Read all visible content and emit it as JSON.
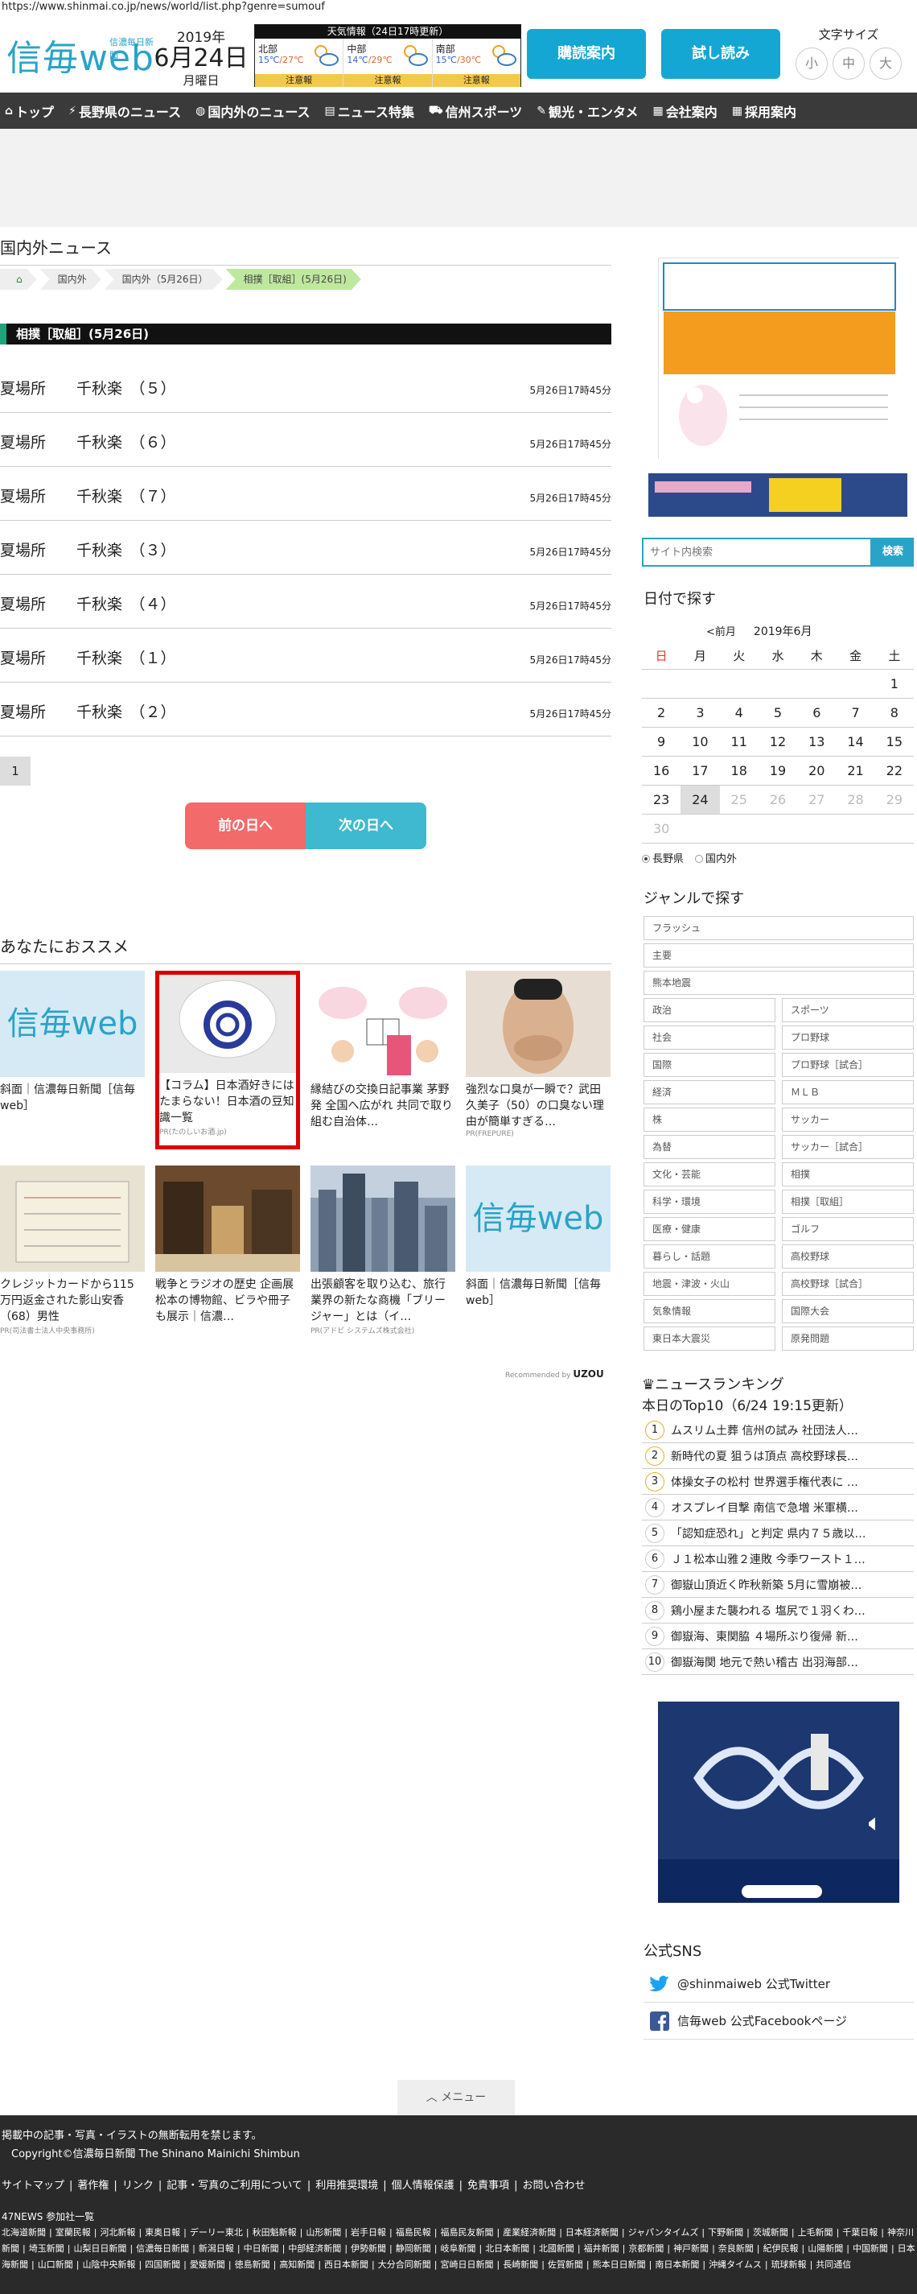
{
  "url": "https://www.shinmai.co.jp/news/world/list.php?genre=sumouf",
  "header": {
    "logo": "信毎web",
    "logo_sub": "信濃毎日新聞",
    "date_year": "2019年",
    "date_main": "6月24日",
    "date_dow": "月曜日",
    "weather_title": "天気情報（24日17時更新）",
    "weather": [
      {
        "name": "北部",
        "hi": "15℃",
        "lo": "27℃",
        "warn": "注意報"
      },
      {
        "name": "中部",
        "hi": "14℃",
        "lo": "29℃",
        "warn": "注意報"
      },
      {
        "name": "南部",
        "hi": "15℃",
        "lo": "30℃",
        "warn": "注意報"
      }
    ],
    "subscribe_label": "購読案内",
    "trial_label": "試し読み",
    "textsize_label": "文字サイズ",
    "textsize_small": "小",
    "textsize_medium": "中",
    "textsize_large": "大"
  },
  "nav": [
    {
      "label": "トップ"
    },
    {
      "label": "長野県のニュース"
    },
    {
      "label": "国内外のニュース"
    },
    {
      "label": "ニュース特集"
    },
    {
      "label": "信州スポーツ"
    },
    {
      "label": "観光・エンタメ"
    },
    {
      "label": "会社案内"
    },
    {
      "label": "採用案内"
    }
  ],
  "main": {
    "section_title": "国内外ニュース",
    "breadcrumbs": [
      "国内外",
      "国内外（5月26日）",
      "相撲［取組］(5月26日)"
    ],
    "category_title": "相撲［取組］(5月26日)",
    "articles": [
      {
        "title": "夏場所　　千秋楽　（５）",
        "time": "5月26日17時45分"
      },
      {
        "title": "夏場所　　千秋楽　（６）",
        "time": "5月26日17時45分"
      },
      {
        "title": "夏場所　　千秋楽　（７）",
        "time": "5月26日17時45分"
      },
      {
        "title": "夏場所　　千秋楽　（３）",
        "time": "5月26日17時45分"
      },
      {
        "title": "夏場所　　千秋楽　（４）",
        "time": "5月26日17時45分"
      },
      {
        "title": "夏場所　　千秋楽　（１）",
        "time": "5月26日17時45分"
      },
      {
        "title": "夏場所　　千秋楽　（２）",
        "time": "5月26日17時45分"
      }
    ],
    "page": "1",
    "prev_day": "前の日へ",
    "next_day": "次の日へ",
    "reco_title": "あなたにおススメ",
    "reco": [
      {
        "text": "斜面｜信濃毎日新聞［信毎web］",
        "pr": "",
        "img": "信毎web"
      },
      {
        "text": "【コラム】日本酒好きにはたまらない！日本酒の豆知識一覧",
        "pr": "PR(たのしいお酒.jp)",
        "img": ""
      },
      {
        "text": "縁結びの交換日記事業 茅野発 全国へ広がれ 共同で取り組む自治体…",
        "pr": "",
        "img": ""
      },
      {
        "text": "強烈な口臭が一瞬で？武田久美子（50）の口臭ない理由が簡単すぎる…",
        "pr": "PR(FREPURE)",
        "img": ""
      },
      {
        "text": "クレジットカードから115万円返金された影山安香（68）男性",
        "pr": "PR(司法書士法人中央事務所)",
        "img": ""
      },
      {
        "text": "戦争とラジオの歴史 企画展 松本の博物館、ビラや冊子も展示｜信濃…",
        "pr": "",
        "img": ""
      },
      {
        "text": "出張顧客を取り込む、旅行業界の新たな商機「ブリージャー」とは（イ…",
        "pr": "PR(アドビ システムズ株式会社)",
        "img": ""
      },
      {
        "text": "斜面｜信濃毎日新聞［信毎web］",
        "pr": "",
        "img": "信毎web"
      }
    ],
    "recommended_by": "Recommended by",
    "recommended_brand": "UZOU"
  },
  "sidebar": {
    "search_placeholder": "サイト内検索",
    "search_btn": "検索",
    "date_title": "日付で探す",
    "cal_prev": "<前月",
    "cal_month": "2019年6月",
    "weekdays": [
      "日",
      "月",
      "火",
      "水",
      "木",
      "金",
      "土"
    ],
    "weeks": [
      [
        "",
        "",
        "",
        "",
        "",
        "",
        "1"
      ],
      [
        "2",
        "3",
        "4",
        "5",
        "6",
        "7",
        "8"
      ],
      [
        "9",
        "10",
        "11",
        "12",
        "13",
        "14",
        "15"
      ],
      [
        "16",
        "17",
        "18",
        "19",
        "20",
        "21",
        "22"
      ],
      [
        "23",
        "24",
        "25",
        "26",
        "27",
        "28",
        "29"
      ],
      [
        "30",
        "",
        "",
        "",
        "",
        "",
        ""
      ]
    ],
    "radio_nagano": "長野県",
    "radio_world": "国内外",
    "genre_title": "ジャンルで探す",
    "genres_wide": [
      "フラッシュ",
      "主要",
      "熊本地震"
    ],
    "genres": [
      "政治",
      "スポーツ",
      "社会",
      "プロ野球",
      "国際",
      "プロ野球［試合］",
      "経済",
      "ＭＬＢ",
      "株",
      "サッカー",
      "為替",
      "サッカー［試合］",
      "文化・芸能",
      "相撲",
      "科学・環境",
      "相撲［取組］",
      "医療・健康",
      "ゴルフ",
      "暮らし・話題",
      "高校野球",
      "地震・津波・火山",
      "高校野球［試合］",
      "気象情報",
      "国際大会",
      "東日本大震災",
      "原発問題"
    ],
    "rank_title": "ニュースランキング",
    "rank_sub": "本日のTop10（6/24 19:15更新）",
    "ranking": [
      "ムスリム土葬 信州の試み 社団法人…",
      "新時代の夏 狙うは頂点 高校野球長…",
      "体操女子の松村 世界選手権代表に …",
      "オスプレイ目撃 南信で急増 米軍横…",
      "「認知症恐れ」と判定 県内７５歳以…",
      "Ｊ１松本山雅２連敗 今季ワースト１…",
      "御嶽山頂近く昨秋新築 5月に雪崩被…",
      "鶏小屋また襲われる 塩尻で１羽くわ…",
      "御嶽海、東関脇 ４場所ぶり復帰 新…",
      "御嶽海関 地元で熱い稽古 出羽海部…"
    ],
    "sns_title": "公式SNS",
    "twitter": "@shinmaiweb 公式Twitter",
    "facebook": "信毎web 公式Facebookページ"
  },
  "menu_label": "メニュー",
  "footer": {
    "notice": "掲載中の記事・写真・イラストの無断転用を禁じます。",
    "copyright": "Copyright©信濃毎日新聞 The Shinano Mainichi Shimbun",
    "links": [
      "サイトマップ",
      "著作権",
      "リンク",
      "記事・写真のご利用について",
      "利用推奨環境",
      "個人情報保護",
      "免責事項",
      "お問い合わせ"
    ],
    "news47": "47NEWS 参加社一覧",
    "papers": [
      "北海道新聞",
      "室蘭民報",
      "河北新報",
      "東奥日報",
      "デーリー東北",
      "秋田魁新報",
      "山形新聞",
      "岩手日報",
      "福島民報",
      "福島民友新聞",
      "産業経済新聞",
      "日本経済新聞",
      "ジャパンタイムズ",
      "下野新聞",
      "茨城新聞",
      "上毛新聞",
      "千葉日報",
      "神奈川新聞",
      "埼玉新聞",
      "山梨日日新聞",
      "信濃毎日新聞",
      "新潟日報",
      "中日新聞",
      "中部経済新聞",
      "伊勢新聞",
      "静岡新聞",
      "岐阜新聞",
      "北日本新聞",
      "北國新聞",
      "福井新聞",
      "京都新聞",
      "神戸新聞",
      "奈良新聞",
      "紀伊民報",
      "山陽新聞",
      "中国新聞",
      "日本海新聞",
      "山口新聞",
      "山陰中央新報",
      "四国新聞",
      "愛媛新聞",
      "徳島新聞",
      "高知新聞",
      "西日本新聞",
      "大分合同新聞",
      "宮崎日日新聞",
      "長崎新聞",
      "佐賀新聞",
      "熊本日日新聞",
      "南日本新聞",
      "沖縄タイムス",
      "琉球新報",
      "共同通信"
    ]
  }
}
